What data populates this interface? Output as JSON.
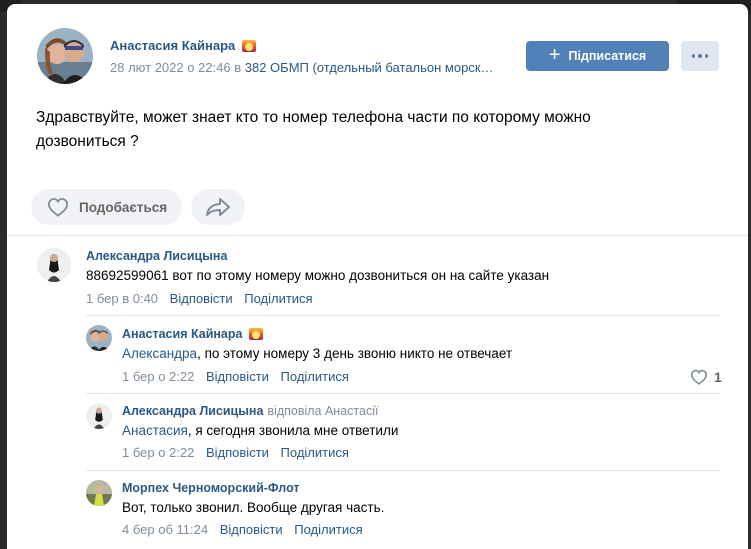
{
  "post": {
    "author": "Анастасия Кайнара",
    "date": "28 лют 2022 о 22:46 в",
    "group": "382 ОБМП (отдельный батальон морск…",
    "subscribe_label": "Підписатися",
    "text": "Здравствуйте, может знает кто то номер телефона части по которому можно дозвониться ?",
    "like_label": "Подобається"
  },
  "comments": [
    {
      "author": "Александра Лисицына",
      "mention": "",
      "text": "88692599061 вот по этому номеру можно дозвониться он на сайте указан",
      "time": "1 бер в 0:40",
      "reply_label": "Відповісти",
      "share_label": "Поділитися"
    },
    {
      "author": "Анастасия Кайнара",
      "mention": "Александра",
      "text": ", по этому номеру 3 день звоню никто не отвечает",
      "time": "1 бер о 2:22",
      "reply_label": "Відповісти",
      "share_label": "Поділитися",
      "likes": "1"
    },
    {
      "author": "Александра Лисицына",
      "replied_to": "відповіла Анастасії",
      "mention": "Анастасия",
      "text": ", я сегодня звонила мне ответили",
      "time": "1 бер о 2:22",
      "reply_label": "Відповісти",
      "share_label": "Поділитися"
    },
    {
      "author": "Морпех Черноморский-Флот",
      "mention": "",
      "text": "Вот, только звонил. Вообще другая часть.",
      "time": "4 бер об 11:24",
      "reply_label": "Відповісти",
      "share_label": "Поділитися"
    }
  ],
  "colors": {
    "link": "#2a5885",
    "accent_button": "#5181b8",
    "muted_text": "#818c99",
    "pill_bg": "#f0f2f5"
  }
}
